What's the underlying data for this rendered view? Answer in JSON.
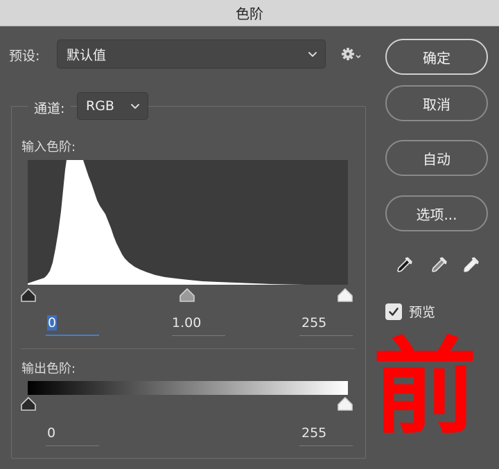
{
  "window": {
    "title": "色阶"
  },
  "preset": {
    "label": "预设:",
    "value": "默认值"
  },
  "buttons": {
    "ok": "确定",
    "cancel": "取消",
    "auto": "自动",
    "options": "选项..."
  },
  "preview": {
    "label": "预览",
    "checked": true
  },
  "channel": {
    "label": "通道:",
    "value": "RGB"
  },
  "input_levels": {
    "label": "输入色阶:",
    "black": "0",
    "gamma": "1.00",
    "white": "255"
  },
  "output_levels": {
    "label": "输出色阶:",
    "black": "0",
    "white": "255"
  },
  "annotation": {
    "text": "前",
    "color": "#ff0000"
  },
  "icons": {
    "gear": "gear-icon",
    "chevron": "chevron-down-icon",
    "eyedroppers": [
      "black-point-eyedropper-icon",
      "gray-point-eyedropper-icon",
      "white-point-eyedropper-icon"
    ]
  },
  "colors": {
    "background": "#535353",
    "titlebar": "#d6d6d6",
    "histogram_bg": "#3c3c3c",
    "field_active": "#3f7fd6"
  }
}
